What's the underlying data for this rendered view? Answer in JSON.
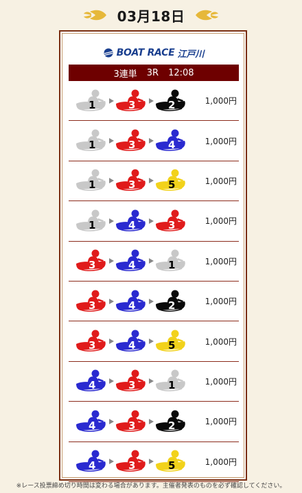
{
  "header": {
    "date": "03月18日"
  },
  "logo": {
    "brand": "BOAT RACE",
    "venue": "江戸川"
  },
  "banner": {
    "bet_type": "3連単",
    "race": "3R",
    "time": "12:08"
  },
  "boat_colors": {
    "1": {
      "body": "#c8c8c8",
      "text": "#000000"
    },
    "2": {
      "body": "#0a0a0a",
      "text": "#ffffff"
    },
    "3": {
      "body": "#e01b1b",
      "text": "#ffffff"
    },
    "4": {
      "body": "#2a2ad0",
      "text": "#ffffff"
    },
    "5": {
      "body": "#f2d21b",
      "text": "#000000"
    }
  },
  "tickets": [
    {
      "combo": [
        "1",
        "3",
        "2"
      ],
      "amount": "1,000円"
    },
    {
      "combo": [
        "1",
        "3",
        "4"
      ],
      "amount": "1,000円"
    },
    {
      "combo": [
        "1",
        "3",
        "5"
      ],
      "amount": "1,000円"
    },
    {
      "combo": [
        "1",
        "4",
        "3"
      ],
      "amount": "1,000円"
    },
    {
      "combo": [
        "3",
        "4",
        "1"
      ],
      "amount": "1,000円"
    },
    {
      "combo": [
        "3",
        "4",
        "2"
      ],
      "amount": "1,000円"
    },
    {
      "combo": [
        "3",
        "4",
        "5"
      ],
      "amount": "1,000円"
    },
    {
      "combo": [
        "4",
        "3",
        "1"
      ],
      "amount": "1,000円"
    },
    {
      "combo": [
        "4",
        "3",
        "2"
      ],
      "amount": "1,000円"
    },
    {
      "combo": [
        "4",
        "3",
        "5"
      ],
      "amount": "1,000円"
    }
  ],
  "footer": {
    "note": "※レース投票締め切り時間は変わる場合があります。主催者発表のものを必ず確認してください。"
  }
}
